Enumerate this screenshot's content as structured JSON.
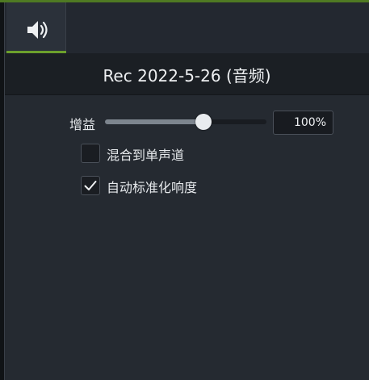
{
  "title": "Rec 2022-5-26 (音频)",
  "tabs": [
    {
      "icon": "speaker-icon",
      "selected": true
    }
  ],
  "gain": {
    "label": "增益",
    "value": "100%",
    "slider_fraction": 0.61
  },
  "options": [
    {
      "label": "混合到单声道",
      "checked": false
    },
    {
      "label": "自动标准化响度",
      "checked": true
    }
  ],
  "colors": {
    "accent": "#6ca02c",
    "background": "#252a31",
    "title_bar": "#1b1f24"
  }
}
